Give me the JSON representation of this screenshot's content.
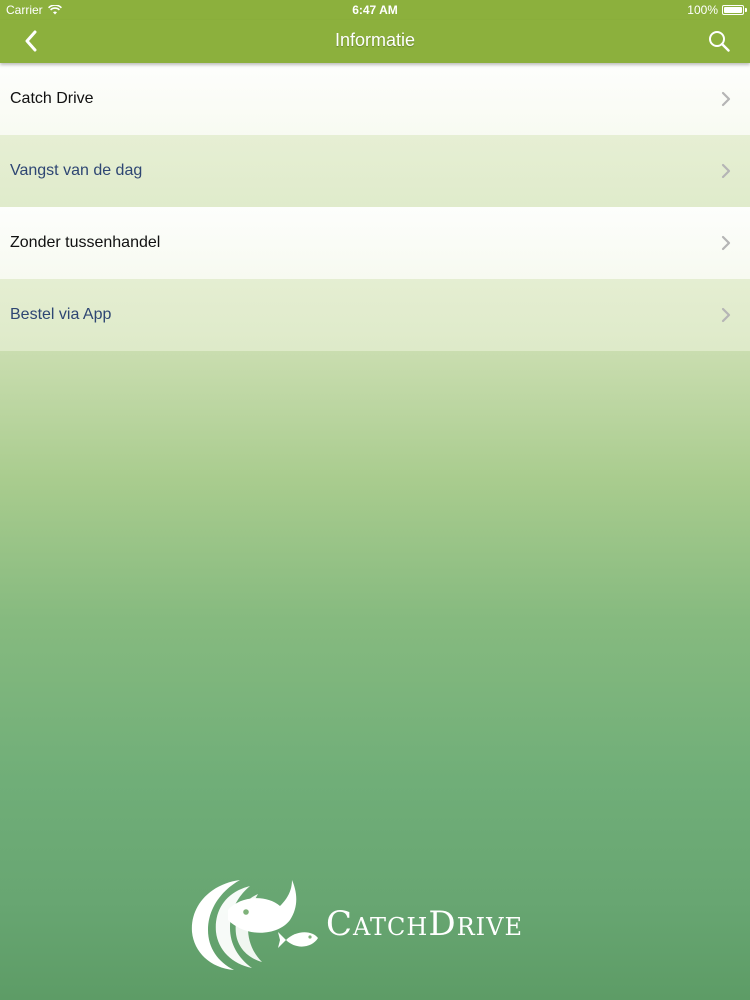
{
  "status_bar": {
    "carrier": "Carrier",
    "time": "6:47 AM",
    "battery": "100%"
  },
  "nav": {
    "title": "Informatie"
  },
  "menu": {
    "items": [
      {
        "label": "Catch Drive"
      },
      {
        "label": "Vangst van de dag"
      },
      {
        "label": "Zonder tussenhandel"
      },
      {
        "label": "Bestel via App"
      }
    ]
  },
  "logo": {
    "text": "CatchDrive"
  },
  "colors": {
    "nav_green": "#8cb03d",
    "link_blue": "#2e4673"
  }
}
